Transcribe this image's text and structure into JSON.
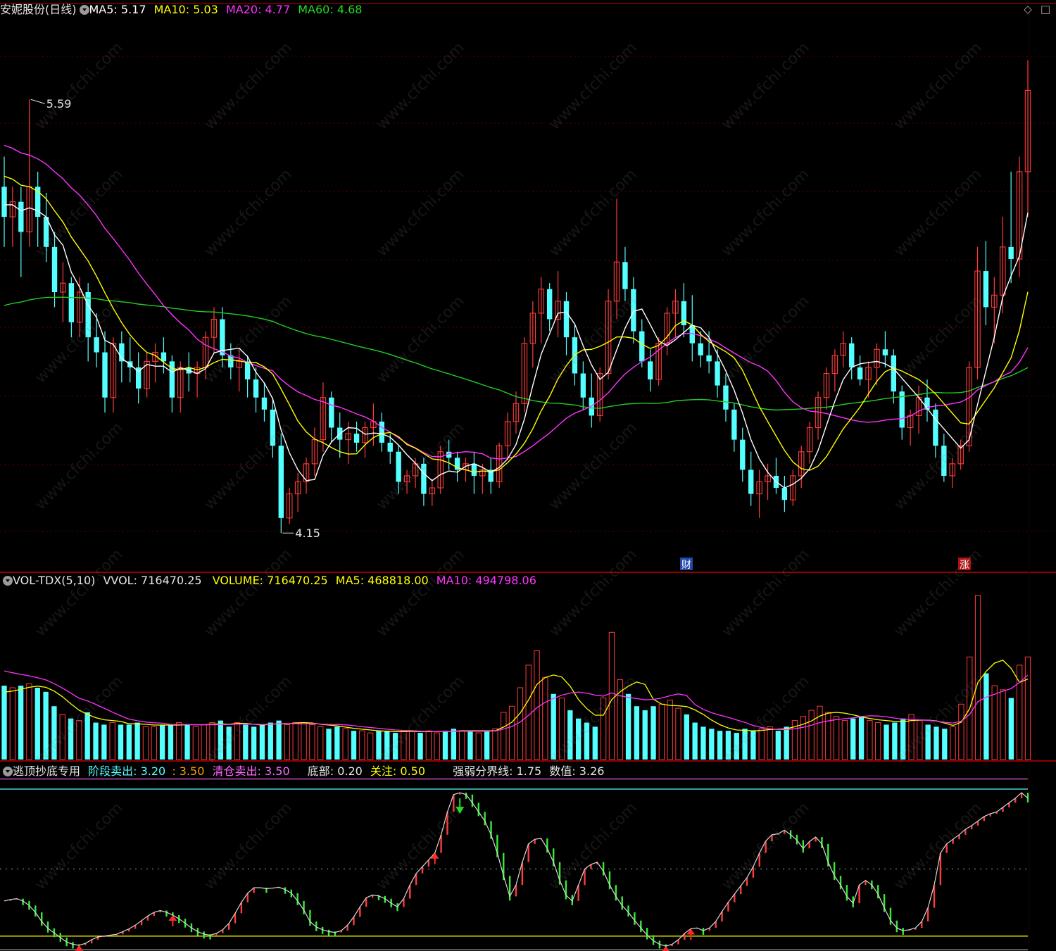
{
  "main_header": {
    "stock": "安妮股份(日线)",
    "ma5": "MA5: 5.17",
    "ma10": "MA10: 5.03",
    "ma20": "MA20: 4.77",
    "ma60": "MA60: 4.68"
  },
  "vol_header": {
    "name": "VOL-TDX(5,10)",
    "vvol": "VVOL: 716470.25",
    "volume": "VOLUME: 716470.25",
    "ma5": "MA5: 468818.00",
    "ma10": "MA10: 494798.06"
  },
  "ind_header": {
    "name": "逃顶抄底专用",
    "stage_sell_label": "阶段卖出: 3.20",
    "stage_sell_level": ": 3.50",
    "clear_sell": "清仓卖出: 3.50",
    "bottom": "底部: 0.20",
    "watch": "关注: 0.50",
    "divide": "强弱分界线: 1.75",
    "value": "数值: 3.26"
  },
  "annotations": {
    "high_label": "5.59",
    "low_label": "4.15",
    "badge_cai": "财",
    "badge_zhang": "涨"
  },
  "watermark": "www.cfchi.com",
  "colors": {
    "up": "#ff3b3b",
    "down": "#54ffff",
    "ma5": "#ffffff",
    "ma10": "#ffff00",
    "ma20": "#ff33ff",
    "ma60": "#22cc22",
    "panel_border": "#c00000"
  },
  "chart_data": [
    {
      "type": "candlestick",
      "title": "安妮股份(日线)",
      "ylim": [
        4.05,
        5.85
      ],
      "candles_ohlc": [
        [
          5.3,
          5.4,
          5.1,
          5.2
        ],
        [
          5.2,
          5.3,
          5.1,
          5.25
        ],
        [
          5.25,
          5.3,
          5.0,
          5.15
        ],
        [
          5.15,
          5.59,
          5.1,
          5.3
        ],
        [
          5.3,
          5.35,
          5.1,
          5.2
        ],
        [
          5.2,
          5.28,
          5.05,
          5.1
        ],
        [
          5.1,
          5.15,
          4.9,
          4.95
        ],
        [
          4.95,
          5.05,
          4.85,
          4.98
        ],
        [
          4.98,
          5.0,
          4.8,
          4.85
        ],
        [
          4.85,
          5.0,
          4.8,
          4.95
        ],
        [
          4.95,
          4.98,
          4.72,
          4.8
        ],
        [
          4.8,
          4.88,
          4.7,
          4.75
        ],
        [
          4.75,
          4.82,
          4.55,
          4.6
        ],
        [
          4.6,
          4.8,
          4.55,
          4.78
        ],
        [
          4.78,
          4.82,
          4.65,
          4.72
        ],
        [
          4.72,
          4.8,
          4.65,
          4.7
        ],
        [
          4.7,
          4.75,
          4.58,
          4.63
        ],
        [
          4.63,
          4.75,
          4.6,
          4.72
        ],
        [
          4.72,
          4.78,
          4.65,
          4.75
        ],
        [
          4.75,
          4.8,
          4.68,
          4.72
        ],
        [
          4.72,
          4.74,
          4.55,
          4.6
        ],
        [
          4.6,
          4.72,
          4.55,
          4.7
        ],
        [
          4.7,
          4.75,
          4.62,
          4.68
        ],
        [
          4.68,
          4.72,
          4.6,
          4.7
        ],
        [
          4.7,
          4.82,
          4.66,
          4.8
        ],
        [
          4.8,
          4.9,
          4.75,
          4.86
        ],
        [
          4.86,
          4.9,
          4.7,
          4.74
        ],
        [
          4.74,
          4.78,
          4.66,
          4.7
        ],
        [
          4.7,
          4.76,
          4.62,
          4.72
        ],
        [
          4.72,
          4.74,
          4.6,
          4.66
        ],
        [
          4.66,
          4.7,
          4.55,
          4.6
        ],
        [
          4.6,
          4.65,
          4.52,
          4.56
        ],
        [
          4.56,
          4.6,
          4.4,
          4.44
        ],
        [
          4.44,
          4.48,
          4.15,
          4.2
        ],
        [
          4.2,
          4.3,
          4.18,
          4.28
        ],
        [
          4.28,
          4.35,
          4.22,
          4.32
        ],
        [
          4.32,
          4.4,
          4.28,
          4.38
        ],
        [
          4.38,
          4.5,
          4.34,
          4.46
        ],
        [
          4.46,
          4.65,
          4.42,
          4.6
        ],
        [
          4.6,
          4.62,
          4.45,
          4.5
        ],
        [
          4.5,
          4.55,
          4.4,
          4.46
        ],
        [
          4.46,
          4.52,
          4.38,
          4.48
        ],
        [
          4.48,
          4.52,
          4.42,
          4.45
        ],
        [
          4.45,
          4.52,
          4.4,
          4.5
        ],
        [
          4.5,
          4.58,
          4.44,
          4.52
        ],
        [
          4.52,
          4.55,
          4.42,
          4.45
        ],
        [
          4.45,
          4.48,
          4.38,
          4.42
        ],
        [
          4.42,
          4.44,
          4.28,
          4.32
        ],
        [
          4.32,
          4.36,
          4.28,
          4.34
        ],
        [
          4.34,
          4.4,
          4.3,
          4.38
        ],
        [
          4.38,
          4.4,
          4.24,
          4.28
        ],
        [
          4.28,
          4.33,
          4.24,
          4.3
        ],
        [
          4.3,
          4.44,
          4.28,
          4.42
        ],
        [
          4.42,
          4.46,
          4.36,
          4.4
        ],
        [
          4.4,
          4.42,
          4.32,
          4.36
        ],
        [
          4.36,
          4.4,
          4.32,
          4.38
        ],
        [
          4.38,
          4.42,
          4.28,
          4.34
        ],
        [
          4.34,
          4.38,
          4.28,
          4.36
        ],
        [
          4.36,
          4.4,
          4.28,
          4.32
        ],
        [
          4.32,
          4.45,
          4.3,
          4.44
        ],
        [
          4.44,
          4.55,
          4.4,
          4.52
        ],
        [
          4.52,
          4.62,
          4.48,
          4.58
        ],
        [
          4.58,
          4.8,
          4.55,
          4.78
        ],
        [
          4.78,
          4.92,
          4.7,
          4.88
        ],
        [
          4.88,
          5.0,
          4.78,
          4.96
        ],
        [
          4.96,
          4.98,
          4.82,
          4.86
        ],
        [
          4.86,
          5.02,
          4.8,
          4.92
        ],
        [
          4.92,
          4.95,
          4.74,
          4.8
        ],
        [
          4.8,
          4.84,
          4.64,
          4.68
        ],
        [
          4.68,
          4.72,
          4.56,
          4.6
        ],
        [
          4.6,
          4.68,
          4.5,
          4.54
        ],
        [
          4.54,
          4.7,
          4.52,
          4.68
        ],
        [
          4.68,
          4.96,
          4.66,
          4.92
        ],
        [
          4.92,
          5.26,
          4.86,
          5.05
        ],
        [
          5.05,
          5.1,
          4.92,
          4.96
        ],
        [
          4.96,
          5.0,
          4.78,
          4.82
        ],
        [
          4.82,
          4.86,
          4.7,
          4.72
        ],
        [
          4.72,
          4.76,
          4.62,
          4.66
        ],
        [
          4.66,
          4.8,
          4.64,
          4.78
        ],
        [
          4.78,
          4.9,
          4.74,
          4.88
        ],
        [
          4.88,
          4.96,
          4.8,
          4.92
        ],
        [
          4.92,
          4.98,
          4.8,
          4.84
        ],
        [
          4.84,
          4.94,
          4.72,
          4.78
        ],
        [
          4.78,
          4.82,
          4.7,
          4.74
        ],
        [
          4.74,
          4.82,
          4.68,
          4.72
        ],
        [
          4.72,
          4.76,
          4.6,
          4.64
        ],
        [
          4.64,
          4.68,
          4.52,
          4.56
        ],
        [
          4.56,
          4.58,
          4.42,
          4.46
        ],
        [
          4.46,
          4.5,
          4.32,
          4.36
        ],
        [
          4.36,
          4.42,
          4.24,
          4.28
        ],
        [
          4.28,
          4.36,
          4.2,
          4.32
        ],
        [
          4.32,
          4.38,
          4.26,
          4.34
        ],
        [
          4.34,
          4.4,
          4.28,
          4.3
        ],
        [
          4.3,
          4.34,
          4.22,
          4.26
        ],
        [
          4.26,
          4.36,
          4.24,
          4.34
        ],
        [
          4.34,
          4.44,
          4.3,
          4.42
        ],
        [
          4.42,
          4.52,
          4.38,
          4.5
        ],
        [
          4.5,
          4.62,
          4.46,
          4.6
        ],
        [
          4.6,
          4.7,
          4.56,
          4.68
        ],
        [
          4.68,
          4.76,
          4.62,
          4.74
        ],
        [
          4.74,
          4.82,
          4.7,
          4.78
        ],
        [
          4.78,
          4.8,
          4.66,
          4.7
        ],
        [
          4.7,
          4.74,
          4.64,
          4.66
        ],
        [
          4.66,
          4.72,
          4.6,
          4.7
        ],
        [
          4.7,
          4.78,
          4.64,
          4.76
        ],
        [
          4.76,
          4.82,
          4.7,
          4.74
        ],
        [
          4.74,
          4.76,
          4.58,
          4.62
        ],
        [
          4.62,
          4.64,
          4.46,
          4.5
        ],
        [
          4.5,
          4.56,
          4.44,
          4.54
        ],
        [
          4.54,
          4.64,
          4.48,
          4.6
        ],
        [
          4.6,
          4.66,
          4.52,
          4.56
        ],
        [
          4.56,
          4.58,
          4.4,
          4.44
        ],
        [
          4.44,
          4.48,
          4.32,
          4.34
        ],
        [
          4.34,
          4.4,
          4.3,
          4.38
        ],
        [
          4.38,
          4.46,
          4.36,
          4.44
        ],
        [
          4.44,
          4.72,
          4.42,
          4.7
        ],
        [
          4.7,
          5.1,
          4.66,
          5.02
        ],
        [
          5.02,
          5.12,
          4.84,
          4.9
        ],
        [
          4.9,
          5.0,
          4.78,
          4.94
        ],
        [
          4.94,
          5.2,
          4.88,
          5.1
        ],
        [
          5.1,
          5.35,
          4.98,
          5.06
        ],
        [
          5.06,
          5.4,
          5.0,
          5.35
        ],
        [
          5.35,
          5.72,
          5.2,
          5.62
        ]
      ],
      "ma_lines": [
        "MA5",
        "MA10",
        "MA20",
        "MA60"
      ]
    },
    {
      "type": "bar",
      "title": "VOL-TDX(5,10)",
      "series": [
        {
          "name": "VOLUME",
          "values": [
            3.6,
            3.5,
            3.6,
            3.7,
            3.5,
            3.3,
            2.6,
            2.2,
            2.0,
            1.9,
            2.3,
            1.8,
            1.7,
            1.8,
            1.7,
            1.7,
            1.8,
            1.6,
            1.6,
            1.7,
            1.7,
            1.8,
            1.7,
            1.6,
            1.7,
            1.8,
            1.9,
            1.6,
            1.8,
            1.7,
            1.6,
            1.7,
            1.8,
            1.9,
            1.7,
            1.8,
            1.8,
            1.7,
            1.6,
            1.5,
            1.6,
            1.5,
            1.4,
            1.4,
            1.3,
            1.4,
            1.4,
            1.3,
            1.4,
            1.4,
            1.3,
            1.4,
            1.3,
            1.4,
            1.5,
            1.4,
            1.4,
            1.3,
            1.4,
            1.5,
            2.3,
            2.6,
            3.5,
            4.6,
            5.3,
            4.0,
            3.2,
            3.0,
            2.4,
            2.0,
            1.8,
            1.6,
            3.0,
            6.2,
            3.9,
            3.2,
            2.6,
            2.4,
            2.6,
            2.7,
            2.9,
            2.5,
            2.2,
            1.8,
            1.6,
            1.5,
            1.4,
            1.4,
            1.3,
            1.5,
            1.4,
            1.5,
            1.6,
            1.4,
            1.6,
            1.9,
            2.1,
            2.4,
            2.6,
            2.3,
            2.1,
            1.9,
            2.0,
            2.1,
            1.9,
            1.8,
            1.7,
            1.8,
            2.0,
            2.2,
            1.9,
            1.7,
            1.6,
            1.5,
            1.6,
            2.7,
            5.0,
            8.0,
            4.2,
            3.6,
            3.4,
            3.0,
            4.6,
            5.0
          ]
        }
      ],
      "moving_averages": [
        "MA5",
        "MA10"
      ]
    },
    {
      "type": "line",
      "title": "逃顶抄底专用",
      "ylim": [
        0,
        3.7
      ],
      "reference_lines": {
        "clear_sell": 3.5,
        "stage_sell": 3.2,
        "divide": 1.75,
        "watch": 0.5,
        "bottom": 0.2
      },
      "series": [
        {
          "name": "数值",
          "values": [
            1.05,
            1.08,
            1.1,
            1.05,
            0.95,
            0.8,
            0.6,
            0.45,
            0.35,
            0.25,
            0.15,
            0.1,
            0.08,
            0.12,
            0.2,
            0.26,
            0.28,
            0.3,
            0.32,
            0.38,
            0.44,
            0.52,
            0.62,
            0.72,
            0.8,
            0.84,
            0.8,
            0.74,
            0.66,
            0.56,
            0.46,
            0.38,
            0.32,
            0.3,
            0.34,
            0.42,
            0.56,
            0.78,
            1.02,
            1.22,
            1.34,
            1.34,
            1.32,
            1.33,
            1.35,
            1.3,
            1.22,
            1.05,
            0.85,
            0.6,
            0.48,
            0.42,
            0.38,
            0.36,
            0.4,
            0.52,
            0.7,
            0.92,
            1.12,
            1.18,
            1.16,
            1.1,
            1.0,
            0.92,
            1.1,
            1.4,
            1.65,
            1.8,
            1.95,
            2.1,
            2.5,
            3.0,
            3.38,
            3.42,
            3.38,
            3.2,
            3.0,
            2.8,
            2.5,
            2.1,
            1.6,
            1.15,
            1.4,
            1.9,
            2.3,
            2.4,
            2.42,
            2.2,
            1.9,
            1.5,
            1.18,
            1.05,
            1.4,
            1.75,
            1.85,
            1.9,
            1.7,
            1.4,
            1.15,
            0.95,
            0.8,
            0.62,
            0.46,
            0.3,
            0.18,
            0.1,
            0.06,
            0.1,
            0.2,
            0.34,
            0.44,
            0.46,
            0.4,
            0.46,
            0.6,
            0.82,
            1.02,
            1.2,
            1.38,
            1.56,
            1.8,
            2.1,
            2.36,
            2.5,
            2.52,
            2.6,
            2.5,
            2.38,
            2.2,
            2.35,
            2.45,
            2.3,
            1.9,
            1.6,
            1.4,
            1.15,
            1.0,
            1.4,
            1.5,
            1.4,
            1.2,
            0.9,
            0.62,
            0.46,
            0.4,
            0.42,
            0.46,
            0.6,
            0.9,
            1.4,
            2.1,
            2.3,
            2.4,
            2.5,
            2.62,
            2.7,
            2.8,
            2.9,
            2.96,
            3.0,
            3.1,
            3.2,
            3.3,
            3.42,
            3.3
          ]
        }
      ]
    }
  ]
}
